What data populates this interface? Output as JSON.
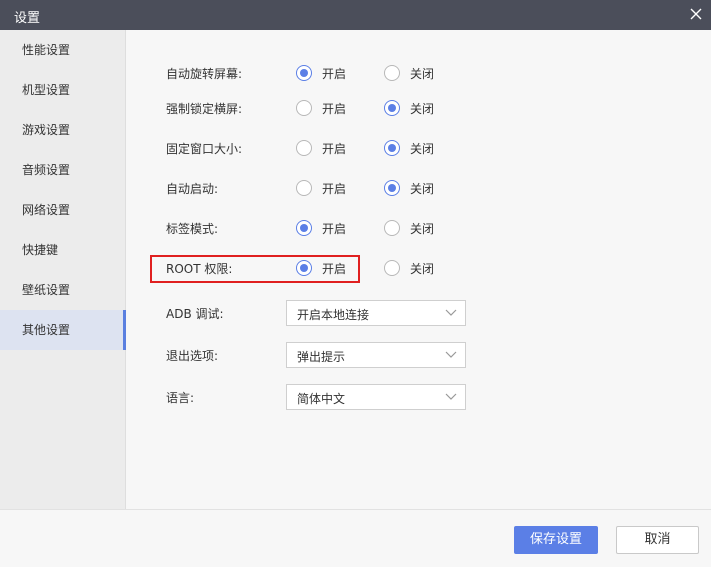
{
  "window": {
    "title": "设置"
  },
  "sidebar": {
    "items": [
      {
        "label": "性能设置"
      },
      {
        "label": "机型设置"
      },
      {
        "label": "游戏设置"
      },
      {
        "label": "音频设置"
      },
      {
        "label": "网络设置"
      },
      {
        "label": "快捷键"
      },
      {
        "label": "壁纸设置"
      },
      {
        "label": "其他设置",
        "active": true
      }
    ]
  },
  "settings": {
    "rows": [
      {
        "label": "自动旋转屏幕:",
        "on_label": "开启",
        "off_label": "关闭",
        "selected": "on"
      },
      {
        "label": "强制锁定横屏:",
        "on_label": "开启",
        "off_label": "关闭",
        "selected": "off"
      },
      {
        "label": "固定窗口大小:",
        "on_label": "开启",
        "off_label": "关闭",
        "selected": "off"
      },
      {
        "label": "自动启动:",
        "on_label": "开启",
        "off_label": "关闭",
        "selected": "off"
      },
      {
        "label": "标签模式:",
        "on_label": "开启",
        "off_label": "关闭",
        "selected": "on"
      },
      {
        "label": "ROOT 权限:",
        "on_label": "开启",
        "off_label": "关闭",
        "selected": "on"
      }
    ],
    "selects": [
      {
        "label": "ADB 调试:",
        "value": "开启本地连接"
      },
      {
        "label": "退出选项:",
        "value": "弹出提示"
      },
      {
        "label": "语言:",
        "value": "简体中文"
      }
    ]
  },
  "footer": {
    "save_label": "保存设置",
    "cancel_label": "取消"
  },
  "colors": {
    "titlebar": "#4b4e5a",
    "accent": "#5b7fe6",
    "highlight_border": "#e02020"
  }
}
